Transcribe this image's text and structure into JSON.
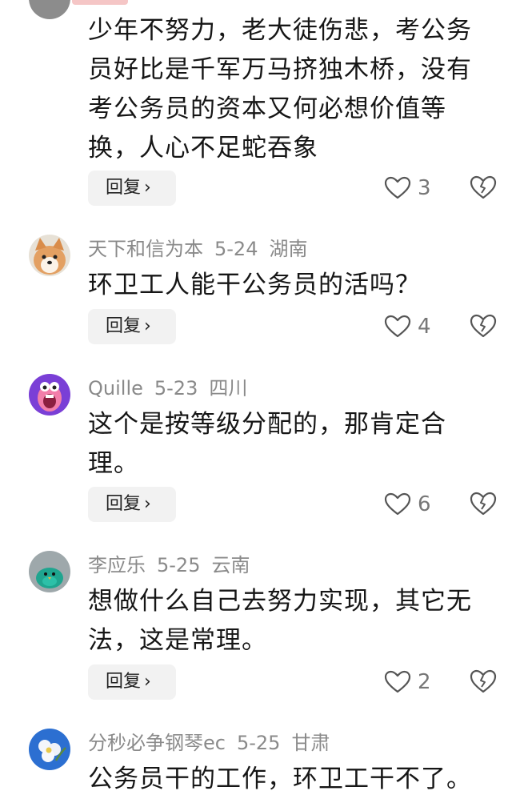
{
  "comments": [
    {
      "text": "少年不努力，老大徒伤悲，考公务\n员好比是千军万马挤独木桥，没有\n考公务员的资本又何必想价值等\n换，人心不足蛇吞象",
      "reply_label": "回复",
      "likes": "3"
    },
    {
      "user": "天下和信为本",
      "date": "5-24",
      "location": "湖南",
      "text": "环卫工人能干公务员的活吗？",
      "reply_label": "回复",
      "likes": "4",
      "avatar": "shiba-dog-avatar"
    },
    {
      "user": "Quille",
      "date": "5-23",
      "location": "四川",
      "text": "这个是按等级分配的，那肯定合\n理。",
      "reply_label": "回复",
      "likes": "6",
      "avatar": "pink-monster-avatar"
    },
    {
      "user": "李应乐",
      "date": "5-25",
      "location": "云南",
      "text": "想做什么自己去努力实现，其它无\n法，这是常理。",
      "reply_label": "回复",
      "likes": "2",
      "avatar": "teal-bird-avatar"
    },
    {
      "user": "分秒必争钢琴ec",
      "date": "5-25",
      "location": "甘肃",
      "text": "公务员干的工作，环卫工干不了。",
      "avatar": "flower-avatar"
    }
  ],
  "colors": {
    "meta_text": "#8a8a8a",
    "reply_bg": "#f2f2f2",
    "icon_stroke": "#555555"
  }
}
